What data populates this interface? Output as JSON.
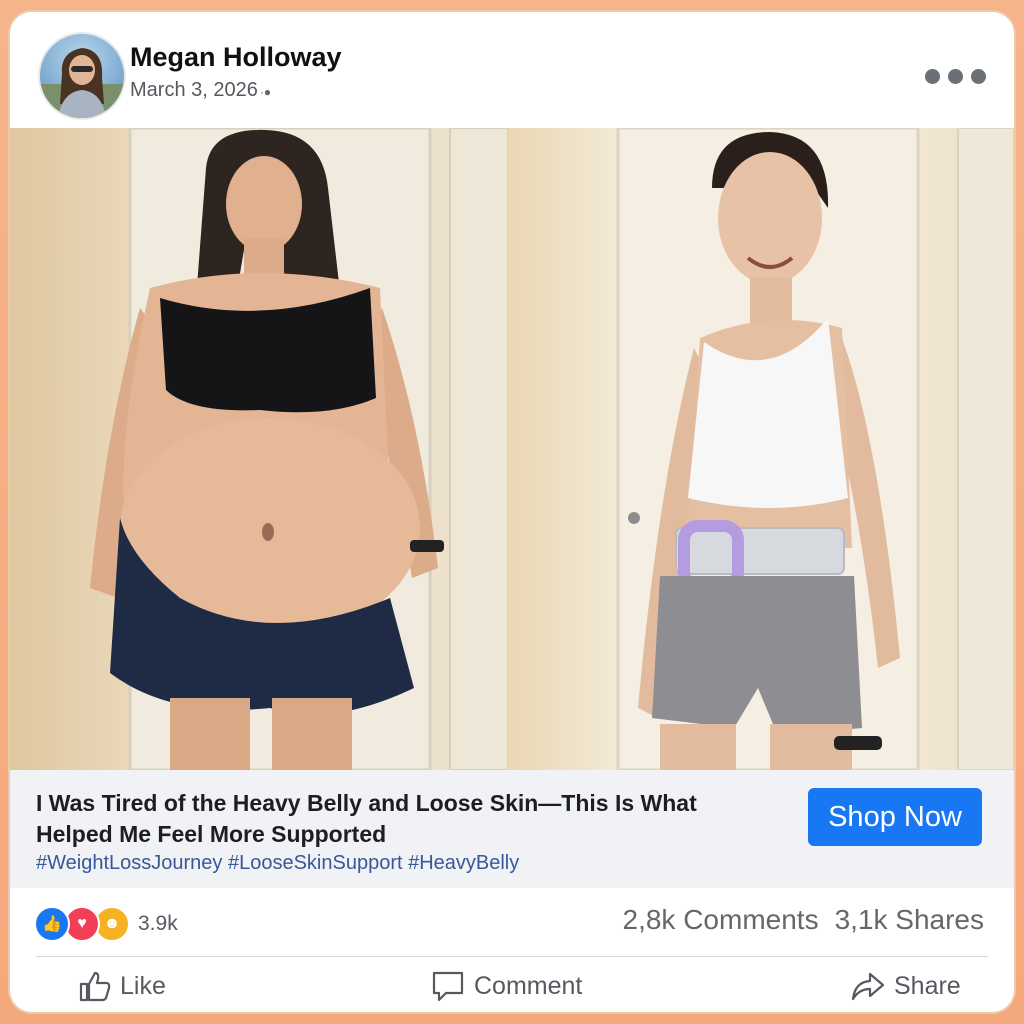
{
  "post": {
    "author": "Megan Holloway",
    "date": "March 3, 2026",
    "privacy_icon": "globe-icon",
    "more_icon": "ellipsis-icon"
  },
  "ad": {
    "headline": "I Was Tired of the Heavy Belly and Loose Skin—This Is What Helped Me Feel More Supported",
    "hashtags": "#WeightLossJourney #LooseSkinSupport #HeavyBelly",
    "cta": "Shop Now"
  },
  "engagement": {
    "reactions_count": "3.9k",
    "reaction_icons": [
      "like-icon",
      "love-icon",
      "care-icon"
    ],
    "comments": "2,8k Comments",
    "shares": "3,1k Shares"
  },
  "actions": {
    "like": "Like",
    "comment": "Comment",
    "share": "Share"
  },
  "colors": {
    "accent": "#1877f2",
    "hashtag": "#385898",
    "background": "#f3a97c"
  }
}
